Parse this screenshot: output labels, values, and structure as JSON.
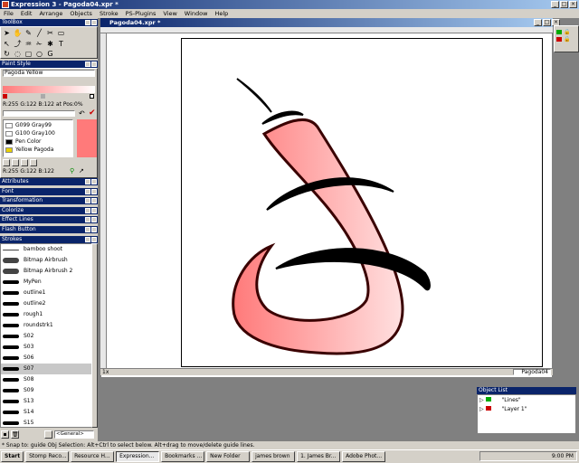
{
  "app": {
    "title": "Expression 3 - Pagoda04.xpr *"
  },
  "menu": [
    "File",
    "Edit",
    "Arrange",
    "Objects",
    "Stroke",
    "PS-Plugins",
    "View",
    "Window",
    "Help"
  ],
  "toolbox": {
    "title": "ToolBox"
  },
  "paint_style": {
    "title": "Paint Style",
    "name": "Pagoda Yellow",
    "gradient_readout": "R:255 G:122 B:122 at Pos:0%",
    "swatches": [
      {
        "label": "G099 Gray99",
        "color": "#fcfcfc"
      },
      {
        "label": "G100 Gray100",
        "color": "#ffffff"
      },
      {
        "label": "Pen Color",
        "color": "#000000"
      },
      {
        "label": "Yellow Pagoda",
        "color": "#e8d000"
      }
    ],
    "color_readout": "R:255  G:122  B:122",
    "fill_color": "#ff7a7a"
  },
  "panels": [
    "Attributes",
    "Font",
    "Transformation",
    "Colorize",
    "Effect Lines",
    "Flash Button"
  ],
  "strokes": {
    "title": "Strokes",
    "items": [
      "bamboo shoot",
      "Bitmap Airbrush",
      "Bitmap Airbrush 2",
      "MyPen",
      "outline1",
      "outline2",
      "rough1",
      "roundstrk1",
      "S02",
      "S03",
      "S06",
      "S07",
      "S08",
      "S09",
      "S13",
      "S14",
      "S15"
    ],
    "selected": "S07",
    "category": "<General>"
  },
  "document": {
    "title": "Pagoda04.xpr *",
    "zoom": "1x",
    "page_name": "Pagoda04"
  },
  "object_list": {
    "title": "Object List",
    "layers": [
      "\"Lines\"",
      "\"Layer 1\""
    ]
  },
  "status": {
    "text": "* Snap to: guide     Obj Selection: Alt+Ctrl to select below. Alt+drag to move/delete guide lines."
  },
  "taskbar": {
    "start": "Start",
    "buttons": [
      "Stomp Reco...",
      "Resource H...",
      "Expression...",
      "Bookmarks ...",
      "New Folder",
      "james brown",
      "1. James Br...",
      "Adobe Phot..."
    ],
    "clock": "9:00 PM"
  }
}
